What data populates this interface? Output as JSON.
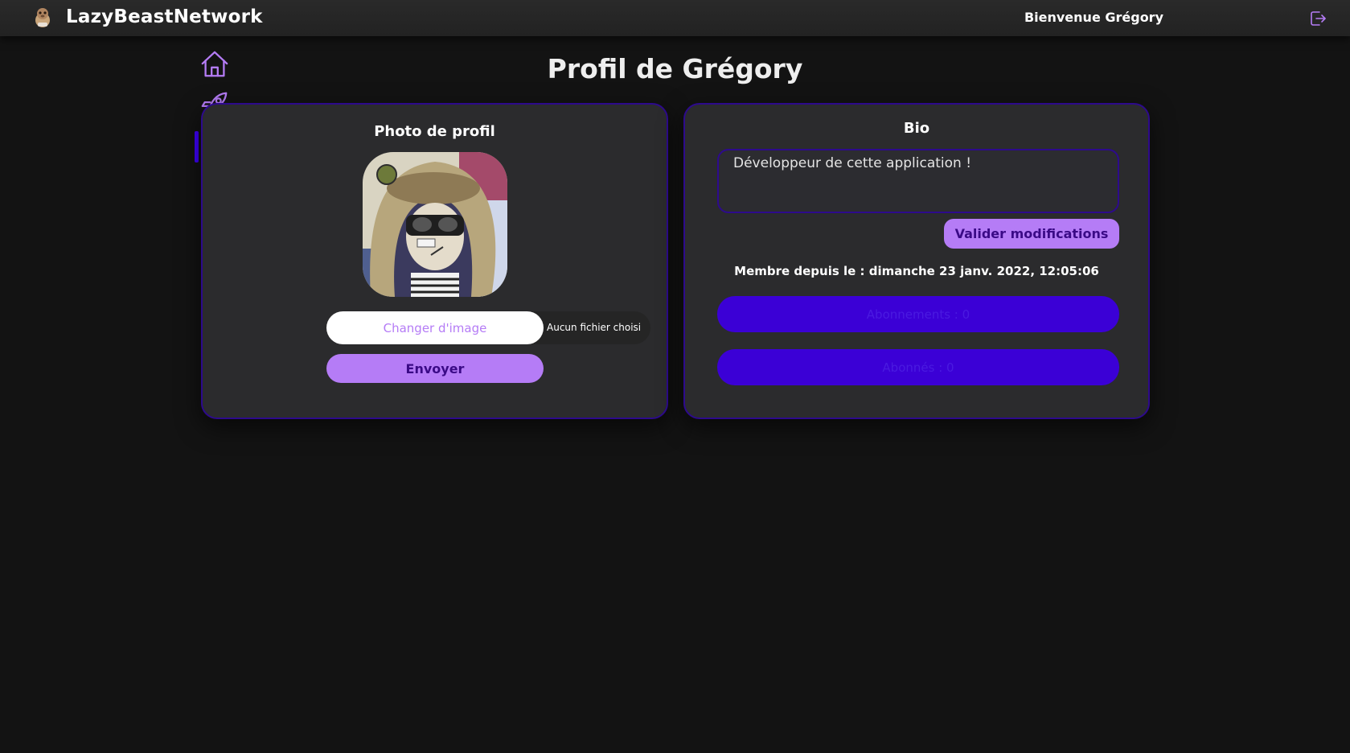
{
  "header": {
    "app_name": "LazyBeastNetwork",
    "welcome": "Bienvenue Grégory",
    "logo_icon": "lazy-beast-logo-icon",
    "logout_icon": "logout-icon"
  },
  "sidebar": {
    "items": [
      {
        "icon": "home-icon",
        "active": false
      },
      {
        "icon": "rocket-icon",
        "active": false
      },
      {
        "icon": "user-icon",
        "active": true
      }
    ]
  },
  "page": {
    "title": "Profil de Grégory"
  },
  "photo_card": {
    "title": "Photo de profil",
    "change_image_label": "Changer d'image",
    "file_status": "Aucun fichier choisi",
    "send_label": "Envoyer"
  },
  "bio_card": {
    "title": "Bio",
    "bio_value": "Développeur de cette application !",
    "validate_label": "Valider modifications",
    "member_since": "Membre depuis le : dimanche 23 janv. 2022, 12:05:06",
    "subscriptions_label": "Abonnements : 0",
    "followers_label": "Abonnés : 0"
  },
  "colors": {
    "background": "#131313",
    "card": "#2b2b2d",
    "accent": "#b57cf6",
    "accent_dark": "#3b00d6",
    "border": "#2d0a8c"
  }
}
